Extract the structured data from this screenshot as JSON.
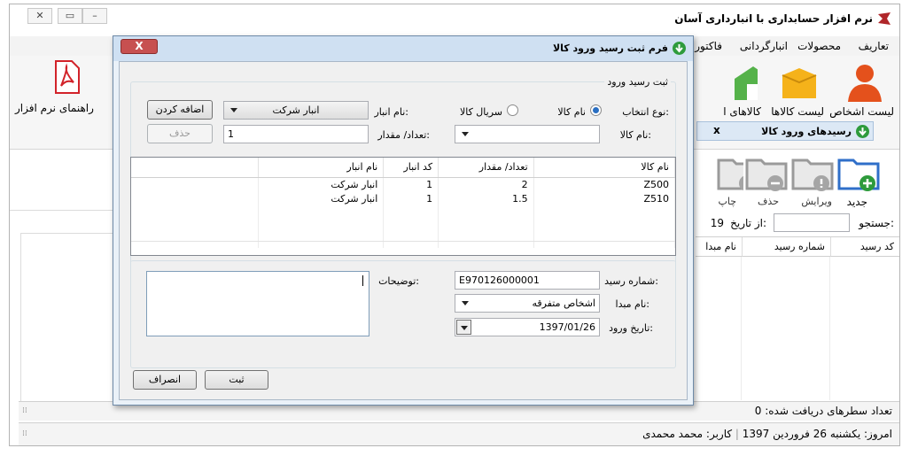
{
  "app": {
    "title": "نرم افزار حسابداری با انبارداری آسان"
  },
  "menu": {
    "items": [
      "تعاریف",
      "محصولات",
      "انبارگردانی",
      "فاکتور"
    ]
  },
  "ribbon": {
    "buttons": [
      "لیست اشخاص",
      "لیست کالاها",
      "کالاهای ا"
    ],
    "help_label": "راهنمای نرم افزار"
  },
  "doc_tab": {
    "title": "رسیدهای ورود کالا",
    "close": "x"
  },
  "toolbar": {
    "new_label": "جدید",
    "edit_label": "ویرایش",
    "delete_label": "حذف",
    "print_label": "چاپ"
  },
  "filter": {
    "search_label": "جستجو:",
    "from_date_label": "از تاریخ:",
    "from_date_partial": "19"
  },
  "main_grid": {
    "columns": [
      "کد رسید",
      "شماره رسید",
      "نام مبدا"
    ]
  },
  "status": {
    "rows_received": "تعداد سطرهای دریافت شده:  0",
    "today": "امروز: یکشنبه 26 فروردین 1397",
    "user": "کاربر: محمد محمدی"
  },
  "dialog": {
    "title": "فرم ثبت رسید ورود کالا",
    "close_label": "X",
    "group_title": "ثبت رسید ورود",
    "selection_type_label": "نوع انتخاب:",
    "radio_product_name": "نام کالا",
    "radio_product_serial": "سریال کالا",
    "warehouse_label": "نام انبار:",
    "warehouse_value": "انبار شرکت",
    "product_name_label": "نام کالا:",
    "product_name_value": "",
    "quantity_label": "تعداد/ مقدار:",
    "quantity_value": "1",
    "add_button": "اضافه کردن",
    "delete_button": "حذف",
    "table": {
      "columns": [
        "نام کالا",
        "تعداد/ مقدار",
        "کد انبار",
        "نام انبار",
        ""
      ],
      "rows": [
        [
          "Z500",
          "2",
          "1",
          "انبار شرکت",
          ""
        ],
        [
          "Z510",
          "1.5",
          "1",
          "انبار شرکت",
          ""
        ]
      ]
    },
    "receipt_number_label": "شماره رسید:",
    "receipt_number_value": "E970126000001",
    "origin_label": "نام مبدا:",
    "origin_value": "اشخاص متفرقه",
    "entry_date_label": "تاریخ ورود:",
    "entry_date_value": "1397/01/26",
    "notes_label": "توضیحات:",
    "notes_value": "",
    "submit_button": "ثبت",
    "cancel_button": "انصراف"
  },
  "colors": {
    "accent_green": "#2e9b3c",
    "dialog_title_bg": "#cfe0f2",
    "close_red": "#c75050",
    "folder_blue": "#2f6fc9"
  }
}
